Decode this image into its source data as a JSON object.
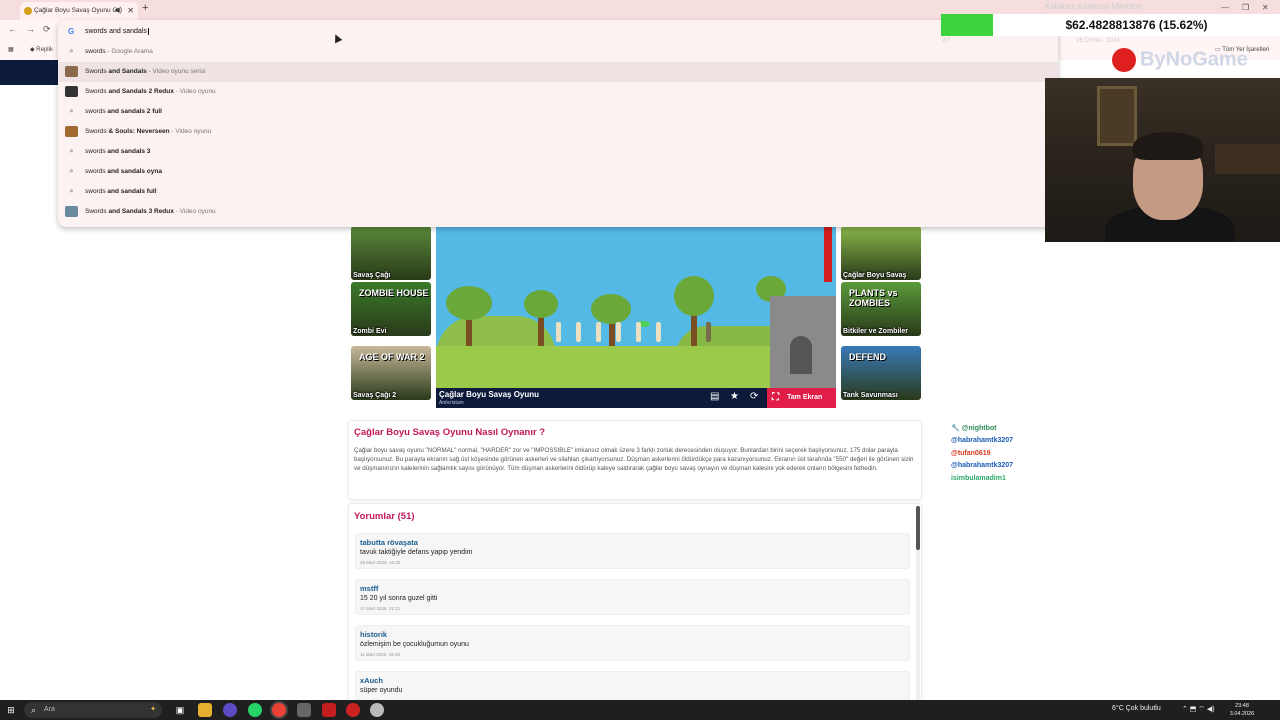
{
  "browser": {
    "tab_title": "Çağlar Boyu Savaş Oyunu O",
    "bookmark_left": "Replik",
    "bookmark_right": "Tüm Yer İşaretleri",
    "omnibox_query": "swords and sandals"
  },
  "suggestions": [
    {
      "prefix": "swords",
      "bold": "",
      "sub": " - Google Arama",
      "icon": "search-icon",
      "thumb": false
    },
    {
      "prefix": "Swords ",
      "bold": "and Sandals",
      "sub": " - Video oyunu serisi",
      "icon": "game-thumb",
      "thumb": true,
      "color": "#8a6a4a"
    },
    {
      "prefix": "Swords ",
      "bold": "and Sandals 2 Redux",
      "sub": " - Video oyunu",
      "icon": "game-thumb",
      "thumb": true,
      "color": "#333333"
    },
    {
      "prefix": "swords ",
      "bold": "and sandals 2 full",
      "sub": "",
      "icon": "search-icon",
      "thumb": false
    },
    {
      "prefix": "Swords ",
      "bold": "& Souls: Neverseen",
      "sub": " - Video oyunu",
      "icon": "game-thumb",
      "thumb": true,
      "color": "#a06a30"
    },
    {
      "prefix": "swords ",
      "bold": "and sandals 3",
      "sub": "",
      "icon": "search-icon",
      "thumb": false
    },
    {
      "prefix": "swords ",
      "bold": "and sandals oyna",
      "sub": "",
      "icon": "search-icon",
      "thumb": false
    },
    {
      "prefix": "swords ",
      "bold": "and sandals full",
      "sub": "",
      "icon": "search-icon",
      "thumb": false
    },
    {
      "prefix": "Swords ",
      "bold": "and Sandals 3 Redux",
      "sub": " - Video oyunu",
      "icon": "game-thumb",
      "thumb": true,
      "color": "#6a8aa0"
    }
  ],
  "overlay": {
    "money": "$62.4828813876 (15.62%)",
    "progress_fraction": 0.1562,
    "faint_top": "Kolaksız Kameralı Mikrofon",
    "brand": "ByNoGame"
  },
  "tiles_left": [
    {
      "label": "Savaş Çağı",
      "color": "#5a8a3a",
      "art": ""
    },
    {
      "label": "Zombi Evi",
      "color": "#3a7a2a",
      "art": "ZOMBIE HOUSE"
    },
    {
      "label": "Savaş Çağı 2",
      "color": "#c8b89a",
      "art": "AGE OF WAR 2"
    }
  ],
  "tiles_right": [
    {
      "label": "Çağlar Boyu Savaş",
      "color": "#8ab84a",
      "art": ""
    },
    {
      "label": "Bitkiler ve Zombiler",
      "color": "#5a9a3a",
      "art": "PLANTS vs ZOMBIES"
    },
    {
      "label": "Tank Savunması",
      "color": "#3a7ab8",
      "art": "DEFEND"
    }
  ],
  "game": {
    "title": "Çağlar Boyu Savaş Oyunu",
    "subtitle": "Anticristum",
    "fullscreen_label": "Tam Ekran"
  },
  "howto": {
    "title": "Çağlar Boyu Savaş Oyunu Nasıl Oynanır ?",
    "text": "Çağlar boyu savaş oyunu \"NORMAL\" normal, \"HARDER\" zor ve \"IMPOSSIBLE\" imkansız olmak üzere 3 farklı zorluk derecesinden oluşuyor. Bunlardan birini seçerek başlıyorsunuz. 175 dolar parayla başlıyorsunuz. Bu parayla ekranın sağ üst köşesinde görünen askerleri ve silahları çıkartıyorsunuz. Düşman askerlerini öldürdükçe para kazanıyorsunuz. Ekranın üst tarafında \"550\" değeri ile görünen sizin ve düşmanınızın kalelerinin sağlamlık sayısı görünüyor. Tüm düşman askerlerini öldürüp kaleye saldırarak çağlar boyu savaş oynayın ve düşman kalesini yok ederek onların bölgesini fethedin."
  },
  "comments": {
    "title": "Yorumlar (51)",
    "items": [
      {
        "user": "tabutta rövaşata",
        "text": "tavuk taktiğiyle defans yapıp yendim",
        "date": "28 Mart 2026, 16:30"
      },
      {
        "user": "mstff",
        "text": "15 20 yıl sonra guzel gitti",
        "date": "21 Mart 2026, 21:21"
      },
      {
        "user": "historik",
        "text": "özlemişim be çocukluğumun oyunu",
        "date": "11 Mart 2026, 15:48"
      },
      {
        "user": "xAuch",
        "text": "süper oyundu",
        "date": ""
      }
    ]
  },
  "chat": [
    {
      "user": "@nightbot",
      "msg": "",
      "color": "#2e8b57"
    },
    {
      "user": "@habrahamtk3207",
      "msg": "",
      "color": "#1a5db8"
    },
    {
      "user": "@tufan0619",
      "msg": "",
      "color": "#d9381e"
    },
    {
      "user": "@habrahamtk3207",
      "msg": "",
      "color": "#1a5db8"
    },
    {
      "user": "isimbulamadim1",
      "msg": "",
      "color": "#2eaa6a"
    }
  ],
  "taskbar": {
    "search_placeholder": "Ara",
    "weather": "6°C  Çok bulutlu",
    "time": "23:48",
    "date": "3.04.2026"
  }
}
